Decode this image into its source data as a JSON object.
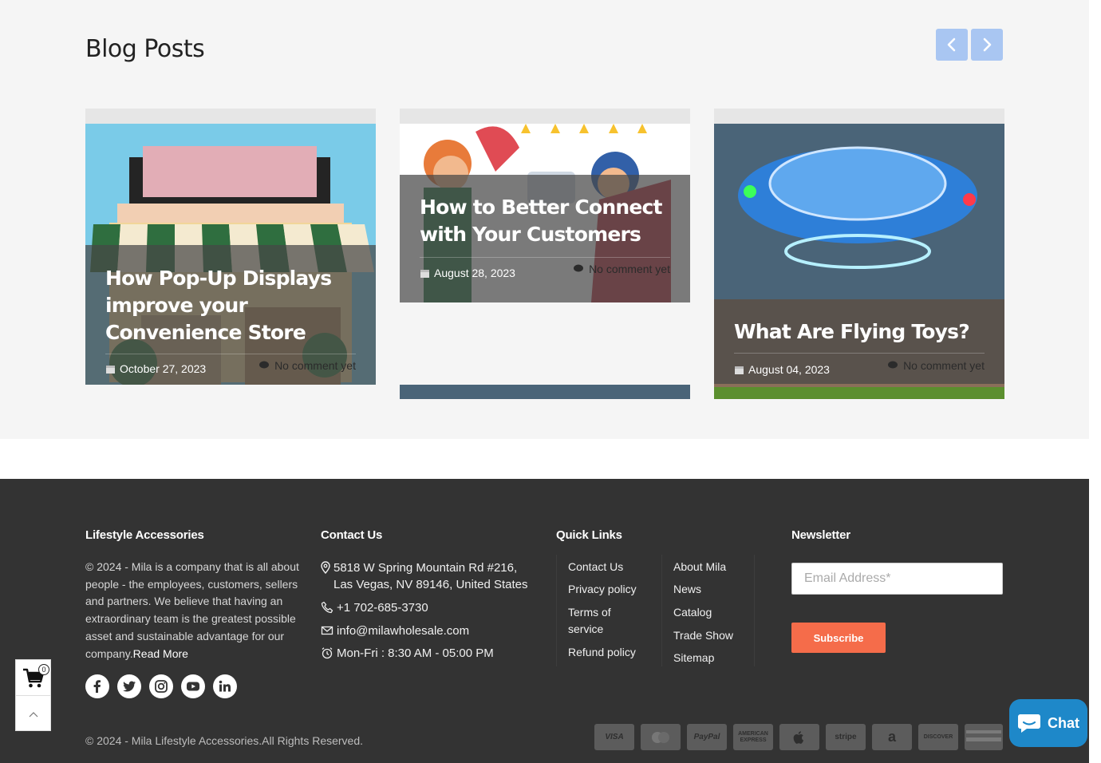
{
  "blog": {
    "heading": "Blog Posts",
    "prev_icon": "chevron-left-icon",
    "next_icon": "chevron-right-icon",
    "posts": [
      {
        "title": "How Pop-Up Displays improve your Convenience Store",
        "date": "October 27, 2023",
        "comments": "No comment yet"
      },
      {
        "title": "How to Better Connect with Your Customers",
        "date": "August 28, 2023",
        "comments": "No comment yet"
      },
      {
        "title": "What Are Flying Toys?",
        "date": "August 04, 2023",
        "comments": "No comment yet"
      }
    ]
  },
  "footer": {
    "about": {
      "heading": "Lifestyle Accessories",
      "text": "© 2024 - Mila is a company that is all about people - the employees, customers, sellers and partners. We believe that having an extraordinary team is the greatest possible asset and sustainable advantage for our company.",
      "read_more": "Read More",
      "social": [
        "facebook-icon",
        "twitter-icon",
        "instagram-icon",
        "youtube-icon",
        "linkedin-icon"
      ]
    },
    "contact": {
      "heading": "Contact Us",
      "address": "5818 W Spring Mountain Rd #216, Las Vegas, NV 89146, United States",
      "phone": "+1 702-685-3730",
      "email": "info@milawholesale.com",
      "hours": "Mon-Fri : 8:30 AM - 05:00 PM"
    },
    "quick_links": {
      "heading": "Quick Links",
      "col1": [
        "Contact Us",
        "Privacy policy",
        "Terms of service",
        "Refund policy"
      ],
      "col2": [
        "About Mila",
        "News",
        "Catalog",
        "Trade Show",
        "Sitemap"
      ]
    },
    "newsletter": {
      "heading": "Newsletter",
      "placeholder": "Email Address*",
      "button": "Subscribe"
    },
    "copyright": "© 2024 - Mila Lifestyle Accessories.All Rights Reserved.",
    "payments": [
      "VISA",
      "",
      "PayPal",
      "AMERICAN EXPRESS",
      "",
      "stripe",
      "a",
      "DISCOVER",
      ""
    ]
  },
  "widgets": {
    "cart_count": "0",
    "chat_label": "Chat"
  },
  "colors": {
    "accent_button": "#f56c4a",
    "nav_button": "#a9c6f2",
    "footer_bg": "#333333",
    "chat": "#1e88c9"
  }
}
